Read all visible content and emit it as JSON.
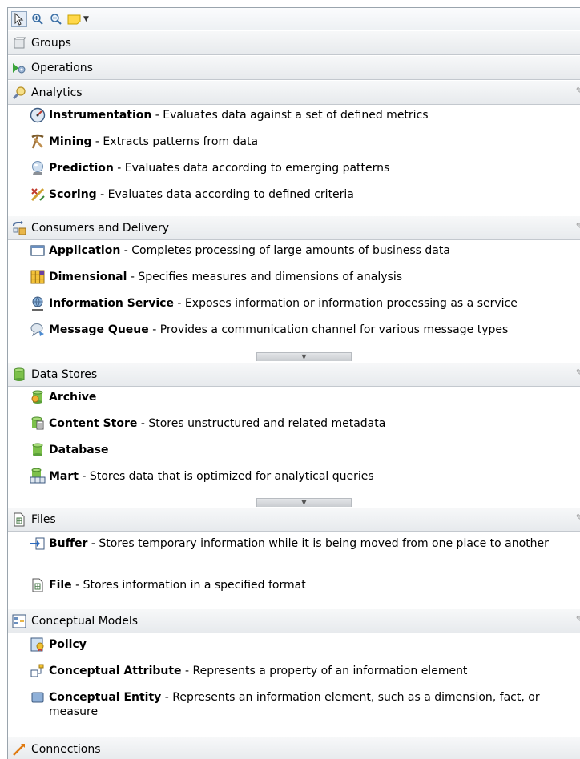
{
  "toolbar": {
    "tools": [
      {
        "name": "select-tool"
      },
      {
        "name": "zoom-in-tool"
      },
      {
        "name": "zoom-out-tool"
      },
      {
        "name": "note-tool"
      }
    ]
  },
  "drawers": {
    "groups": {
      "label": "Groups"
    },
    "operations": {
      "label": "Operations"
    },
    "analytics": {
      "label": "Analytics",
      "items": [
        {
          "name": "Instrumentation",
          "desc": " - Evaluates data against a set of defined metrics"
        },
        {
          "name": "Mining",
          "desc": " - Extracts patterns from data"
        },
        {
          "name": "Prediction",
          "desc": " - Evaluates data according to emerging patterns"
        },
        {
          "name": "Scoring",
          "desc": " - Evaluates data according to defined criteria"
        }
      ]
    },
    "consumers": {
      "label": "Consumers and Delivery",
      "items": [
        {
          "name": "Application",
          "desc": " - Completes processing of large amounts of business data"
        },
        {
          "name": "Dimensional",
          "desc": " - Specifies measures and dimensions of analysis"
        },
        {
          "name": "Information Service",
          "desc": " - Exposes information or information processing as a service"
        },
        {
          "name": "Message Queue",
          "desc": " - Provides a communication channel for various message types"
        }
      ]
    },
    "datastores": {
      "label": "Data Stores",
      "items": [
        {
          "name": "Archive",
          "desc": ""
        },
        {
          "name": "Content Store",
          "desc": " - Stores unstructured and related metadata"
        },
        {
          "name": "Database",
          "desc": ""
        },
        {
          "name": "Mart",
          "desc": " - Stores data that is optimized for analytical queries"
        }
      ]
    },
    "files": {
      "label": "Files",
      "items": [
        {
          "name": "Buffer",
          "desc": " - Stores temporary information while it is being moved from one place to another"
        },
        {
          "name": "File",
          "desc": " - Stores information in a specified format"
        }
      ]
    },
    "conceptual": {
      "label": "Conceptual Models",
      "items": [
        {
          "name": "Policy",
          "desc": ""
        },
        {
          "name": "Conceptual Attribute",
          "desc": " - Represents a property of an information element"
        },
        {
          "name": "Conceptual Entity",
          "desc": " - Represents an information element, such as a dimension, fact, or measure"
        }
      ]
    },
    "connections": {
      "label": "Connections"
    }
  }
}
